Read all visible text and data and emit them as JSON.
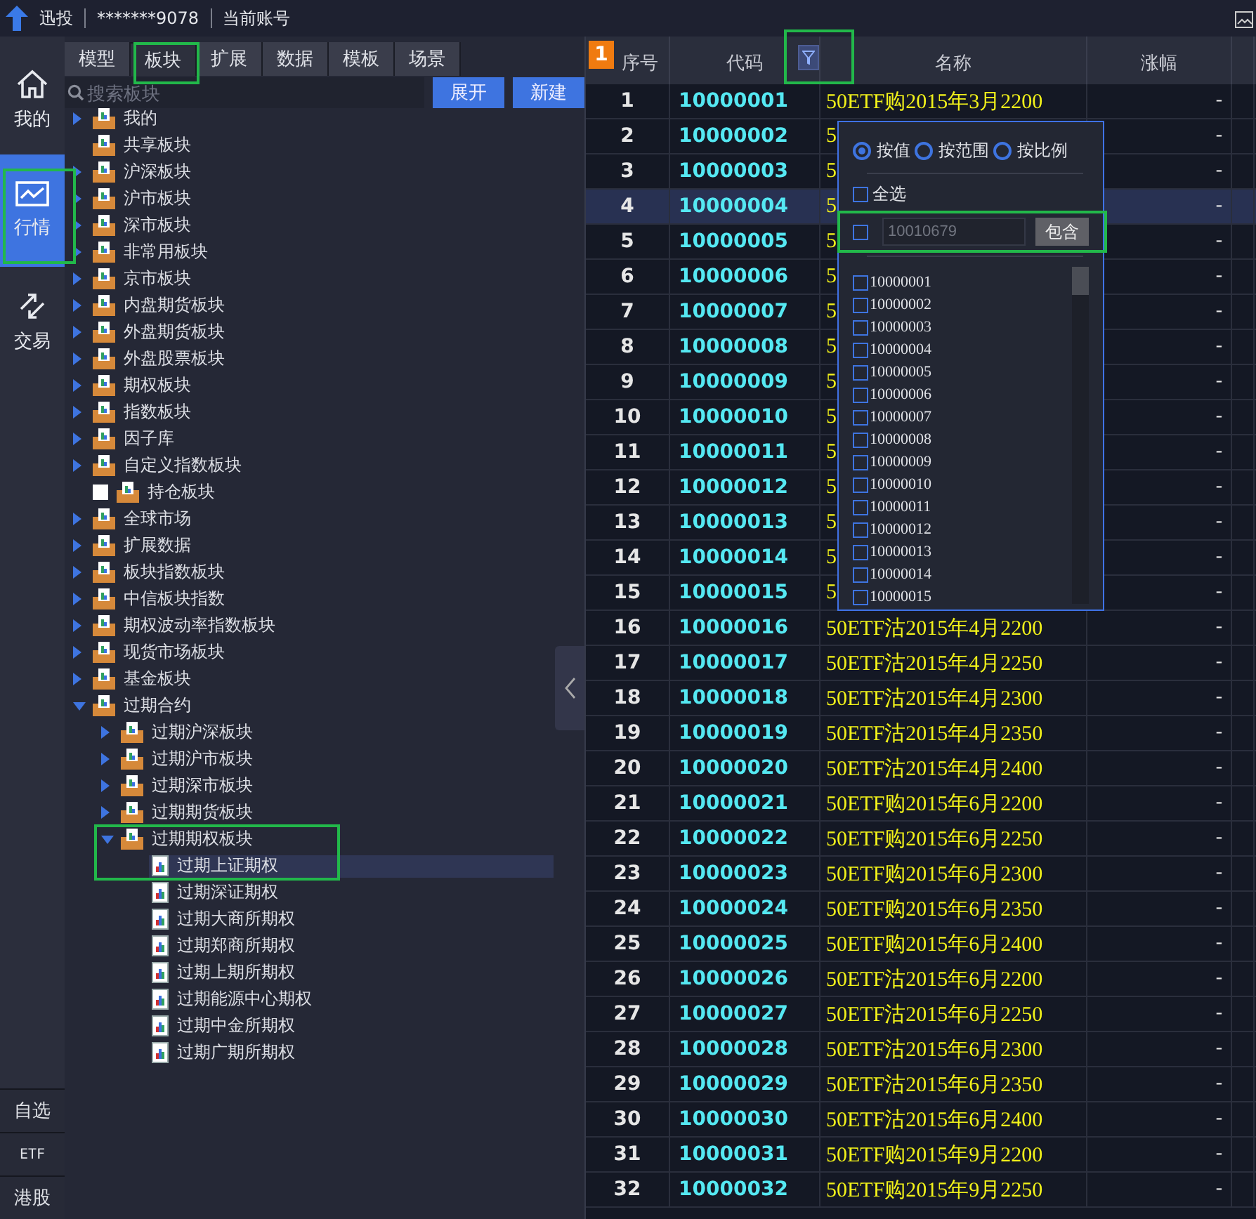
{
  "top_bar": {
    "brand": "迅投",
    "account": "*******9078",
    "account_label": "当前账号"
  },
  "nav": {
    "items": [
      {
        "label": "我的",
        "selected": false
      },
      {
        "label": "行情",
        "selected": true
      },
      {
        "label": "交易",
        "selected": false
      }
    ],
    "bottom_items": [
      "自选",
      "ETF",
      "港股"
    ]
  },
  "panel": {
    "tabs": [
      {
        "label": "模型",
        "selected": false
      },
      {
        "label": "板块",
        "selected": true
      },
      {
        "label": "扩展",
        "selected": false
      },
      {
        "label": "数据",
        "selected": false
      },
      {
        "label": "模板",
        "selected": false
      },
      {
        "label": "场景",
        "selected": false
      }
    ],
    "search": {
      "placeholder": "搜索板块"
    },
    "buttons": [
      "展开",
      "新建"
    ],
    "tree": [
      {
        "label": "我的",
        "kind": "folder",
        "expanded": false
      },
      {
        "label": "共享板块",
        "kind": "folder"
      },
      {
        "label": "沪深板块",
        "kind": "folder",
        "expanded": false
      },
      {
        "label": "沪市板块",
        "kind": "folder",
        "expanded": false
      },
      {
        "label": "深市板块",
        "kind": "folder",
        "expanded": false
      },
      {
        "label": "非常用板块",
        "kind": "folder",
        "expanded": false
      },
      {
        "label": "京市板块",
        "kind": "folder",
        "expanded": false
      },
      {
        "label": "内盘期货板块",
        "kind": "folder",
        "expanded": false
      },
      {
        "label": "外盘期货板块",
        "kind": "folder",
        "expanded": false
      },
      {
        "label": "外盘股票板块",
        "kind": "folder",
        "expanded": false
      },
      {
        "label": "期权板块",
        "kind": "folder",
        "expanded": false
      },
      {
        "label": "指数板块",
        "kind": "folder",
        "expanded": false
      },
      {
        "label": "因子库",
        "kind": "folder",
        "expanded": false
      },
      {
        "label": "自定义指数板块",
        "kind": "folder",
        "expanded": false
      },
      {
        "label": "持仓板块",
        "kind": "check_folder",
        "checked": false
      },
      {
        "label": "全球市场",
        "kind": "folder",
        "expanded": false
      },
      {
        "label": "扩展数据",
        "kind": "folder",
        "expanded": false
      },
      {
        "label": "板块指数板块",
        "kind": "folder",
        "expanded": false
      },
      {
        "label": "中信板块指数",
        "kind": "folder",
        "expanded": false
      },
      {
        "label": "期权波动率指数板块",
        "kind": "folder",
        "expanded": false
      },
      {
        "label": "现货市场板块",
        "kind": "folder",
        "expanded": false
      },
      {
        "label": "基金板块",
        "kind": "folder",
        "expanded": false
      },
      {
        "label": "过期合约",
        "kind": "folder",
        "expanded": true,
        "children": [
          {
            "label": "过期沪深板块",
            "kind": "folder",
            "expanded": false
          },
          {
            "label": "过期沪市板块",
            "kind": "folder",
            "expanded": false
          },
          {
            "label": "过期深市板块",
            "kind": "folder",
            "expanded": false
          },
          {
            "label": "过期期货板块",
            "kind": "folder",
            "expanded": false
          },
          {
            "label": "过期期权板块",
            "kind": "folder",
            "expanded": true,
            "children": [
              {
                "label": "过期上证期权",
                "kind": "file",
                "selected": true
              },
              {
                "label": "过期深证期权",
                "kind": "file",
                "selected": false
              },
              {
                "label": "过期大商所期权",
                "kind": "file",
                "selected": false
              },
              {
                "label": "过期郑商所期权",
                "kind": "file",
                "selected": false
              },
              {
                "label": "过期上期所期权",
                "kind": "file",
                "selected": false
              },
              {
                "label": "过期能源中心期权",
                "kind": "file",
                "selected": false
              },
              {
                "label": "过期中金所期权",
                "kind": "file",
                "selected": false
              },
              {
                "label": "过期广期所期权",
                "kind": "file",
                "selected": false
              }
            ]
          }
        ]
      }
    ]
  },
  "table": {
    "badge": "1",
    "columns": [
      "序号",
      "代码",
      "名称",
      "涨幅"
    ],
    "rows": [
      {
        "seq": "1",
        "code": "10000001",
        "name": "50ETF购2015年3月2200",
        "change": "-",
        "selected": false
      },
      {
        "seq": "2",
        "code": "10000002",
        "name": "5",
        "change": "-",
        "selected": false
      },
      {
        "seq": "3",
        "code": "10000003",
        "name": "5",
        "change": "-",
        "selected": false
      },
      {
        "seq": "4",
        "code": "10000004",
        "name": "5",
        "change": "-",
        "selected": true
      },
      {
        "seq": "5",
        "code": "10000005",
        "name": "5",
        "change": "-",
        "selected": false
      },
      {
        "seq": "6",
        "code": "10000006",
        "name": "5",
        "change": "-",
        "selected": false
      },
      {
        "seq": "7",
        "code": "10000007",
        "name": "5",
        "change": "-",
        "selected": false
      },
      {
        "seq": "8",
        "code": "10000008",
        "name": "5",
        "change": "-",
        "selected": false
      },
      {
        "seq": "9",
        "code": "10000009",
        "name": "5",
        "change": "-",
        "selected": false
      },
      {
        "seq": "10",
        "code": "10000010",
        "name": "5",
        "change": "-",
        "selected": false
      },
      {
        "seq": "11",
        "code": "10000011",
        "name": "5",
        "change": "-",
        "selected": false
      },
      {
        "seq": "12",
        "code": "10000012",
        "name": "5",
        "change": "-",
        "selected": false
      },
      {
        "seq": "13",
        "code": "10000013",
        "name": "5",
        "change": "-",
        "selected": false
      },
      {
        "seq": "14",
        "code": "10000014",
        "name": "5",
        "change": "-",
        "selected": false
      },
      {
        "seq": "15",
        "code": "10000015",
        "name": "5",
        "change": "-",
        "selected": false
      },
      {
        "seq": "16",
        "code": "10000016",
        "name": "50ETF沽2015年4月2200",
        "change": "-",
        "selected": false
      },
      {
        "seq": "17",
        "code": "10000017",
        "name": "50ETF沽2015年4月2250",
        "change": "-",
        "selected": false
      },
      {
        "seq": "18",
        "code": "10000018",
        "name": "50ETF沽2015年4月2300",
        "change": "-",
        "selected": false
      },
      {
        "seq": "19",
        "code": "10000019",
        "name": "50ETF沽2015年4月2350",
        "change": "-",
        "selected": false
      },
      {
        "seq": "20",
        "code": "10000020",
        "name": "50ETF沽2015年4月2400",
        "change": "-",
        "selected": false
      },
      {
        "seq": "21",
        "code": "10000021",
        "name": "50ETF购2015年6月2200",
        "change": "-",
        "selected": false
      },
      {
        "seq": "22",
        "code": "10000022",
        "name": "50ETF购2015年6月2250",
        "change": "-",
        "selected": false
      },
      {
        "seq": "23",
        "code": "10000023",
        "name": "50ETF购2015年6月2300",
        "change": "-",
        "selected": false
      },
      {
        "seq": "24",
        "code": "10000024",
        "name": "50ETF购2015年6月2350",
        "change": "-",
        "selected": false
      },
      {
        "seq": "25",
        "code": "10000025",
        "name": "50ETF购2015年6月2400",
        "change": "-",
        "selected": false
      },
      {
        "seq": "26",
        "code": "10000026",
        "name": "50ETF沽2015年6月2200",
        "change": "-",
        "selected": false
      },
      {
        "seq": "27",
        "code": "10000027",
        "name": "50ETF沽2015年6月2250",
        "change": "-",
        "selected": false
      },
      {
        "seq": "28",
        "code": "10000028",
        "name": "50ETF沽2015年6月2300",
        "change": "-",
        "selected": false
      },
      {
        "seq": "29",
        "code": "10000029",
        "name": "50ETF沽2015年6月2350",
        "change": "-",
        "selected": false
      },
      {
        "seq": "30",
        "code": "10000030",
        "name": "50ETF沽2015年6月2400",
        "change": "-",
        "selected": false
      },
      {
        "seq": "31",
        "code": "10000031",
        "name": "50ETF购2015年9月2200",
        "change": "-",
        "selected": false
      },
      {
        "seq": "32",
        "code": "10000032",
        "name": "50ETF购2015年9月2250",
        "change": "-",
        "selected": false
      }
    ]
  },
  "filter_popup": {
    "modes": [
      {
        "label": "按值",
        "selected": true
      },
      {
        "label": "按范围",
        "selected": false
      },
      {
        "label": "按比例",
        "selected": false
      }
    ],
    "select_all": {
      "label": "全选",
      "checked": false
    },
    "search": {
      "checked": false,
      "placeholder": "10010679"
    },
    "contain_button": "包含",
    "values": [
      {
        "label": "10000001",
        "checked": false
      },
      {
        "label": "10000002",
        "checked": false
      },
      {
        "label": "10000003",
        "checked": false
      },
      {
        "label": "10000004",
        "checked": false
      },
      {
        "label": "10000005",
        "checked": false
      },
      {
        "label": "10000006",
        "checked": false
      },
      {
        "label": "10000007",
        "checked": false
      },
      {
        "label": "10000008",
        "checked": false
      },
      {
        "label": "10000009",
        "checked": false
      },
      {
        "label": "10000010",
        "checked": false
      },
      {
        "label": "10000011",
        "checked": false
      },
      {
        "label": "10000012",
        "checked": false
      },
      {
        "label": "10000013",
        "checked": false
      },
      {
        "label": "10000014",
        "checked": false
      },
      {
        "label": "10000015",
        "checked": false
      }
    ]
  }
}
